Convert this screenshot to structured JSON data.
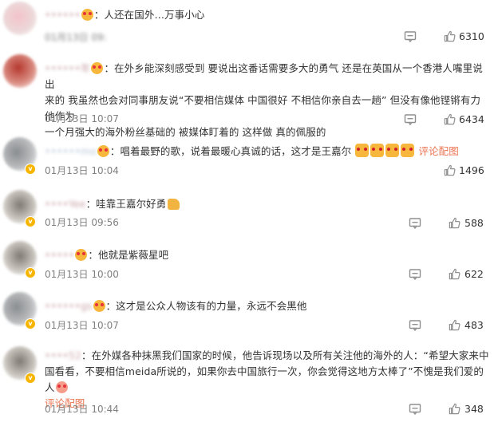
{
  "comments": [
    {
      "username": "••••••",
      "text": "：人还在国外…万事小心",
      "time": "01月13日 09:",
      "likes": "6310"
    },
    {
      "username": "••••••年",
      "text_line1": "：在外乡能深刻感受到 要说出这番话需要多大的勇气 还是在英国从一个香港人嘴里说出",
      "text_line2": "来的 我虽然也会对同事朋友说“不要相信媒体 中国很好 不相信你亲自去一趟” 但没有像他铿锵有力 他作为",
      "text_line3": "一个月强大的海外粉丝基础的 被媒体盯着的 这样做 真的佩服的",
      "time": "01月13日 10:07",
      "likes": "6434"
    },
    {
      "username": "••••••mo",
      "text": "：唱着最野的歌，说着最暖心真诚的话，这才是王嘉尔",
      "pic_link": "评论配图",
      "time": "01月13日 10:04",
      "likes": "1496"
    },
    {
      "username": "••••Yee",
      "text": "：哇靠王嘉尔好勇",
      "time": "01月13日 09:56",
      "likes": "588"
    },
    {
      "username": "•••••",
      "text": "：他就是紫薇星吧",
      "time": "01月13日 10:00",
      "likes": "622"
    },
    {
      "username": "••••••gs",
      "text": "：这才是公众人物该有的力量，永远不会黑他",
      "time": "01月13日 10:07",
      "likes": "483"
    },
    {
      "username": "••••52",
      "text_line1": "：在外媒各种抹黑我们国家的时候，他告诉现场以及所有关注他的海外的人：“希望大家来中",
      "text_line2": "国看看，不要相信meida所说的，如果你去中国旅行一次，你会觉得这地方太棒了”不愧是我们爱的人",
      "pic_link": "评论配图",
      "time": "01月13日 10:44",
      "likes": "348"
    }
  ],
  "icons": {
    "reply": "reply-icon",
    "like": "thumb-up-icon"
  },
  "colors": {
    "link": "#eb7350",
    "time": "#808080",
    "badge": "#f7b500"
  }
}
